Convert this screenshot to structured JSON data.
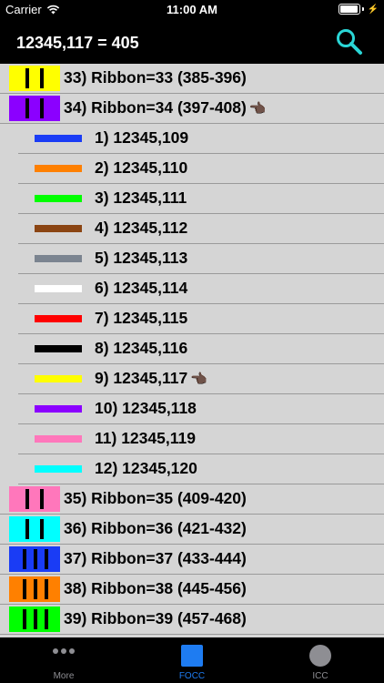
{
  "status_bar": {
    "carrier": "Carrier",
    "time": "11:00 AM"
  },
  "nav": {
    "title": "12345,117 = 405"
  },
  "list": [
    {
      "type": "parent",
      "label": "33) Ribbon=33 (385-396)",
      "swatch": "#ffff00",
      "stripes": 2,
      "pointer": false
    },
    {
      "type": "parent",
      "label": "34) Ribbon=34 (397-408)",
      "swatch": "#8b00ff",
      "stripes": 2,
      "pointer": true
    },
    {
      "type": "child",
      "label": "1) 12345,109",
      "color": "#1a3cf5",
      "pointer": false
    },
    {
      "type": "child",
      "label": "2) 12345,110",
      "color": "#ff8000",
      "pointer": false
    },
    {
      "type": "child",
      "label": "3) 12345,111",
      "color": "#00ff00",
      "pointer": false
    },
    {
      "type": "child",
      "label": "4) 12345,112",
      "color": "#8b4513",
      "pointer": false
    },
    {
      "type": "child",
      "label": "5) 12345,113",
      "color": "#7b8490",
      "pointer": false
    },
    {
      "type": "child",
      "label": "6) 12345,114",
      "color": "#ffffff",
      "pointer": false
    },
    {
      "type": "child",
      "label": "7) 12345,115",
      "color": "#ff0000",
      "pointer": false
    },
    {
      "type": "child",
      "label": "8) 12345,116",
      "color": "#000000",
      "pointer": false
    },
    {
      "type": "child",
      "label": "9) 12345,117",
      "color": "#ffff00",
      "pointer": true
    },
    {
      "type": "child",
      "label": "10) 12345,118",
      "color": "#8b00ff",
      "pointer": false
    },
    {
      "type": "child",
      "label": "11) 12345,119",
      "color": "#ff77bb",
      "pointer": false
    },
    {
      "type": "child",
      "label": "12) 12345,120",
      "color": "#00ffff",
      "pointer": false
    },
    {
      "type": "parent",
      "label": "35) Ribbon=35 (409-420)",
      "swatch": "#ff77bb",
      "stripes": 2,
      "pointer": false
    },
    {
      "type": "parent",
      "label": "36) Ribbon=36 (421-432)",
      "swatch": "#00ffff",
      "stripes": 2,
      "pointer": false
    },
    {
      "type": "parent",
      "label": "37) Ribbon=37 (433-444)",
      "swatch": "#1a3cf5",
      "stripes": 3,
      "pointer": false
    },
    {
      "type": "parent",
      "label": "38) Ribbon=38 (445-456)",
      "swatch": "#ff8000",
      "stripes": 3,
      "pointer": false
    },
    {
      "type": "parent",
      "label": "39) Ribbon=39 (457-468)",
      "swatch": "#00ff00",
      "stripes": 3,
      "pointer": false
    }
  ],
  "tabs": [
    {
      "label": "More",
      "icon": "more-icon",
      "active": false
    },
    {
      "label": "FOCC",
      "icon": "square-icon",
      "active": true
    },
    {
      "label": "ICC",
      "icon": "circle-icon",
      "active": false
    }
  ],
  "colors": {
    "accent": "#1e7cf2",
    "list_bg": "#d5d5d5",
    "search_icon": "#2ad6d6"
  },
  "pointer_glyph": "👈🏿"
}
